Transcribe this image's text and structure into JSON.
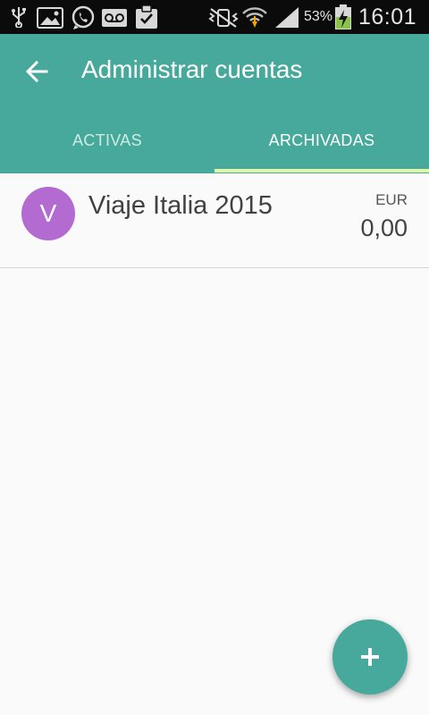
{
  "status_bar": {
    "icons": [
      "usb-icon",
      "image-icon",
      "whatsapp-icon",
      "voicemail-icon",
      "clipboard-check-icon",
      "mute-vibrate-icon",
      "wifi-icon",
      "signal-icon",
      "battery-charging-icon"
    ],
    "battery_percent": "53%",
    "time": "16:01"
  },
  "appbar": {
    "color": "#47a99b",
    "back_icon": "arrow-back-icon",
    "title": "Administrar cuentas"
  },
  "tabs": {
    "items": [
      {
        "label": "ACTIVAS",
        "selected": false
      },
      {
        "label": "ARCHIVADAS",
        "selected": true
      }
    ],
    "indicator_color": "#e5f7a3"
  },
  "accounts": [
    {
      "initial": "V",
      "name": "Viaje Italia 2015",
      "currency": "EUR",
      "balance": "0,00",
      "avatar_color": "#b36ad1"
    }
  ],
  "fab": {
    "icon": "plus-icon",
    "color": "#47a99b"
  }
}
